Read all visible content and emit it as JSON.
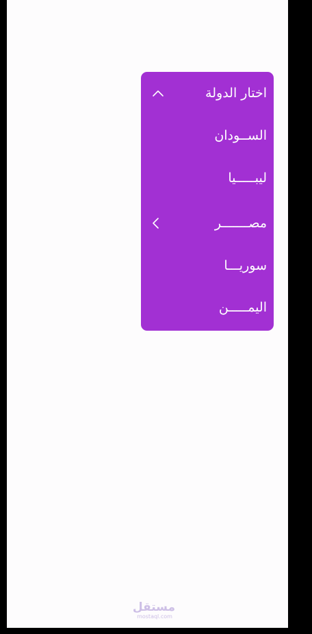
{
  "dropdown": {
    "title": "اختار الدولة",
    "header_icon": "chevron-up-icon",
    "items": [
      {
        "label": "الســودان"
      },
      {
        "label": "ليبـــــيا"
      },
      {
        "label": "مصـــــــر",
        "icon": "chevron-left-icon"
      },
      {
        "label": "سوريـــا"
      },
      {
        "label": "اليمـــــن"
      }
    ]
  },
  "watermark": {
    "brand": "مستقل",
    "domain": "mostaql.com"
  },
  "colors": {
    "dropdown_bg": "#a230d3",
    "screen_bg": "#fdfcfd",
    "frame": "#000000",
    "text": "#ffffff"
  }
}
